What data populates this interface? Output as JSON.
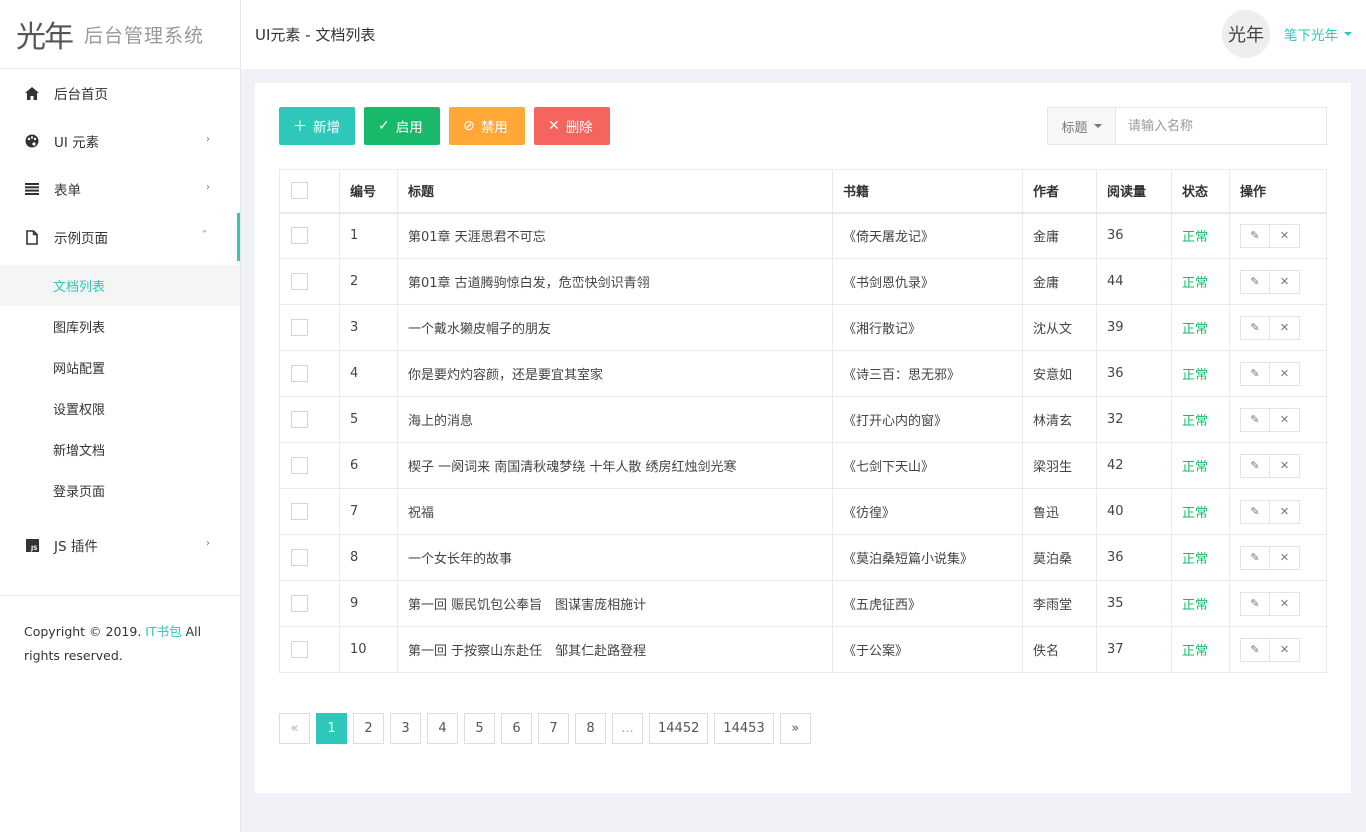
{
  "app": {
    "logo_mark": "光年",
    "logo_text": "后台管理系统"
  },
  "header": {
    "title": "UI元素 - 文档列表",
    "avatar_text": "光年",
    "username": "笔下光年"
  },
  "sidebar": {
    "items": [
      {
        "label": "后台首页",
        "icon": "home-icon",
        "arrow": ""
      },
      {
        "label": "UI 元素",
        "icon": "palette-icon",
        "arrow": "›"
      },
      {
        "label": "表单",
        "icon": "list-icon",
        "arrow": "›"
      },
      {
        "label": "示例页面",
        "icon": "file-icon",
        "arrow": "˅"
      }
    ],
    "sub_items": [
      "文档列表",
      "图库列表",
      "网站配置",
      "设置权限",
      "新增文档",
      "登录页面"
    ],
    "js_item": {
      "label": "JS 插件",
      "icon": "js-icon",
      "arrow": "›"
    },
    "footer": {
      "prefix": "Copyright © 2019.",
      "link": "IT书包",
      "suffix": "All rights reserved."
    }
  },
  "toolbar": {
    "add_label": "新增",
    "enable_label": "启用",
    "disable_label": "禁用",
    "delete_label": "删除",
    "colors": {
      "add": "#2ec7b9",
      "enable": "#18b96a",
      "disable": "#ffa836",
      "delete": "#f5645e"
    }
  },
  "search": {
    "select_label": "标题",
    "placeholder": "请输入名称"
  },
  "table": {
    "headers": [
      "编号",
      "标题",
      "书籍",
      "作者",
      "阅读量",
      "状态",
      "操作"
    ],
    "rows": [
      {
        "id": "1",
        "title": "第01章 天涯思君不可忘",
        "book": "《倚天屠龙记》",
        "author": "金庸",
        "reads": "36",
        "status": "正常"
      },
      {
        "id": "2",
        "title": "第01章 古道腾驹惊白发，危峦快剑识青翎",
        "book": "《书剑恩仇录》",
        "author": "金庸",
        "reads": "44",
        "status": "正常"
      },
      {
        "id": "3",
        "title": "一个戴水獭皮帽子的朋友",
        "book": "《湘行散记》",
        "author": "沈从文",
        "reads": "39",
        "status": "正常"
      },
      {
        "id": "4",
        "title": "你是要灼灼容颜，还是要宜其室家",
        "book": "《诗三百：思无邪》",
        "author": "安意如",
        "reads": "36",
        "status": "正常"
      },
      {
        "id": "5",
        "title": "海上的消息",
        "book": "《打开心内的窗》",
        "author": "林清玄",
        "reads": "32",
        "status": "正常"
      },
      {
        "id": "6",
        "title": "楔子 一阕词来 南国清秋魂梦绕 十年人散 绣房红烛剑光寒",
        "book": "《七剑下天山》",
        "author": "梁羽生",
        "reads": "42",
        "status": "正常"
      },
      {
        "id": "7",
        "title": "祝福",
        "book": "《彷徨》",
        "author": "鲁迅",
        "reads": "40",
        "status": "正常"
      },
      {
        "id": "8",
        "title": "一个女长年的故事",
        "book": "《莫泊桑短篇小说集》",
        "author": "莫泊桑",
        "reads": "36",
        "status": "正常"
      },
      {
        "id": "9",
        "title": "第一回 赈民饥包公奉旨　图谋害庞相施计",
        "book": "《五虎征西》",
        "author": "李雨堂",
        "reads": "35",
        "status": "正常"
      },
      {
        "id": "10",
        "title": "第一回 于按察山东赴任　邹其仁赴路登程",
        "book": "《于公案》",
        "author": "佚名",
        "reads": "37",
        "status": "正常"
      }
    ]
  },
  "pagination": {
    "prev": "«",
    "pages": [
      "1",
      "2",
      "3",
      "4",
      "5",
      "6",
      "7",
      "8",
      "...",
      "14452",
      "14453"
    ],
    "next": "»",
    "current": "1"
  }
}
